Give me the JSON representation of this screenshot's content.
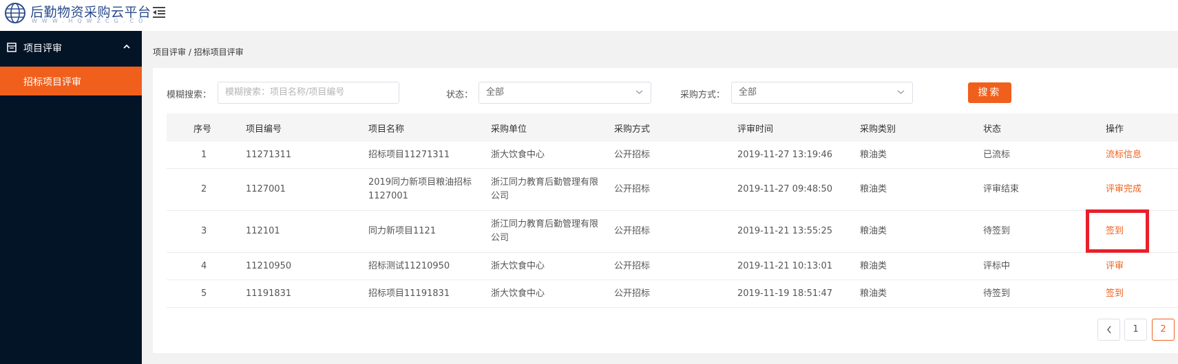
{
  "app": {
    "brand_title": "后勤物资采购云平台",
    "brand_subtitle": "WWW.HQWZCG.CO"
  },
  "sidebar": {
    "group_label": "项目评审",
    "items": [
      {
        "label": "招标项目评审",
        "active": true
      }
    ]
  },
  "breadcrumb": "项目评审 / 招标项目评审",
  "filters": {
    "keyword_label": "模糊搜索：",
    "keyword_placeholder": "模糊搜索：项目名称/项目编号",
    "status_label": "状态：",
    "status_value": "全部",
    "method_label": "采购方式：",
    "method_value": "全部",
    "search_button": "搜索"
  },
  "table": {
    "columns": [
      "序号",
      "项目编号",
      "项目名称",
      "采购单位",
      "采购方式",
      "评审时间",
      "采购类别",
      "状态",
      "操作"
    ],
    "rows": [
      {
        "index": "1",
        "code": "11271311",
        "name": "招标项目11271311",
        "unit": "浙大饮食中心",
        "method": "公开招标",
        "time": "2019-11-27 13:19:46",
        "category": "粮油类",
        "status": "已流标",
        "action": "流标信息"
      },
      {
        "index": "2",
        "code": "1127001",
        "name": "2019同力新项目粮油招标1127001",
        "unit": "浙江同力教育后勤管理有限公司",
        "method": "公开招标",
        "time": "2019-11-27 09:48:50",
        "category": "粮油类",
        "status": "评审结束",
        "action": "评审完成"
      },
      {
        "index": "3",
        "code": "112101",
        "name": "同力新项目1121",
        "unit": "浙江同力教育后勤管理有限公司",
        "method": "公开招标",
        "time": "2019-11-21 13:55:25",
        "category": "粮油类",
        "status": "待签到",
        "action": "签到"
      },
      {
        "index": "4",
        "code": "11210950",
        "name": "招标测试11210950",
        "unit": "浙大饮食中心",
        "method": "公开招标",
        "time": "2019-11-21 10:13:01",
        "category": "粮油类",
        "status": "评标中",
        "action": "评审"
      },
      {
        "index": "5",
        "code": "11191831",
        "name": "招标项目11191831",
        "unit": "浙大饮食中心",
        "method": "公开招标",
        "time": "2019-11-19 18:51:47",
        "category": "粮油类",
        "status": "待签到",
        "action": "签到"
      }
    ]
  },
  "pagination": {
    "prev": "<",
    "pages": [
      "1",
      "2"
    ],
    "current": "2"
  },
  "colors": {
    "accent": "#f0601c",
    "sidebar_bg": "#041427",
    "highlight_box": "#e8202a"
  },
  "icons": {
    "logo": "globe-logo-icon",
    "menu_toggle": "menu-fold-icon",
    "group": "form-icon",
    "group_arrow": "chevron-up-icon",
    "select_arrow": "chevron-down-icon",
    "prev_page": "chevron-left-icon"
  }
}
